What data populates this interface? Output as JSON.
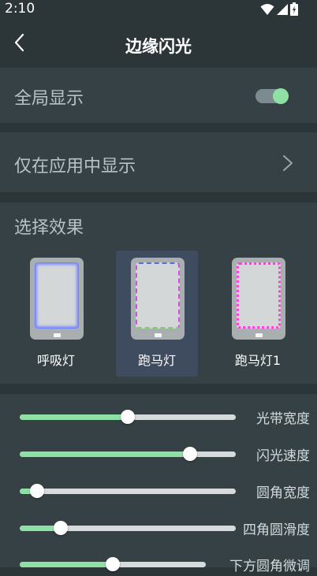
{
  "status_bar": {
    "time": "2:10"
  },
  "app_bar": {
    "title": "边缘闪光"
  },
  "global_display": {
    "label": "全局显示",
    "enabled": true
  },
  "app_only_display": {
    "label": "仅在应用中显示"
  },
  "effect_section": {
    "title": "选择效果",
    "selected_index": 1,
    "items": [
      {
        "label": "呼吸灯",
        "border_style": "glow",
        "border_color": "#6f82ff"
      },
      {
        "label": "跑马灯",
        "border_style": "dashed-multicolor",
        "border_colors": [
          "#5b6fd6",
          "#d44fd6",
          "#7fcf6a"
        ]
      },
      {
        "label": "跑马灯1",
        "border_style": "dotted",
        "border_color": "#ff3fd8"
      }
    ]
  },
  "sliders": [
    {
      "label": "光带宽度",
      "value": 0.5
    },
    {
      "label": "闪光速度",
      "value": 0.79
    },
    {
      "label": "圆角宽度",
      "value": 0.08
    },
    {
      "label": "四角圆滑度",
      "value": 0.19
    },
    {
      "label": "下方圆角微调",
      "value": 0.5
    }
  ],
  "colors": {
    "accent": "#8fe0a4",
    "background": "#2c3538",
    "card": "#364145",
    "selected": "#3f4b5e"
  }
}
